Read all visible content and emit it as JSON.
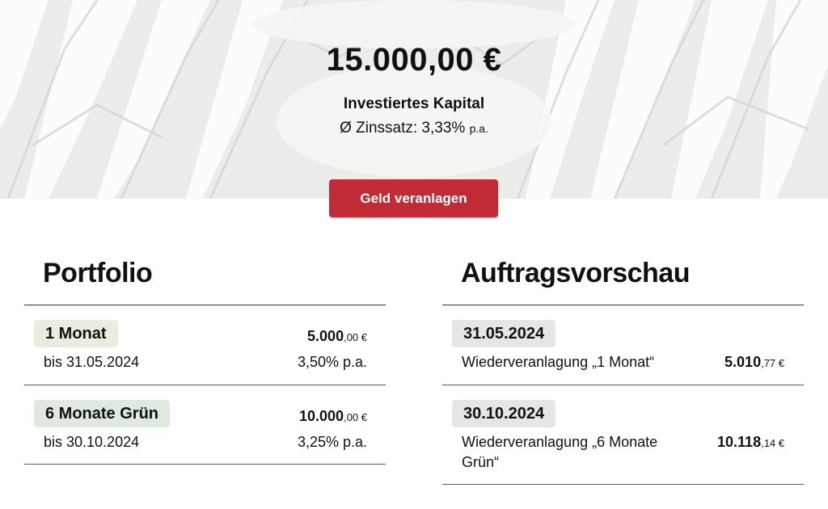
{
  "summary": {
    "total": "15.000,00 €",
    "label": "Investiertes Kapital",
    "rate_prefix": "Ø Zinssatz: 3,33%",
    "rate_unit": "p.a."
  },
  "actions": {
    "invest_label": "Geld veranlagen"
  },
  "portfolio": {
    "title": "Portfolio",
    "items": [
      {
        "tag": "1 Monat",
        "until": "bis 31.05.2024",
        "amount_main": "5.000",
        "amount_cents": ",00 €",
        "rate": "3,50% p.a."
      },
      {
        "tag": "6 Monate Grün",
        "until": "bis 30.10.2024",
        "amount_main": "10.000",
        "amount_cents": ",00 €",
        "rate": "3,25% p.a."
      }
    ]
  },
  "preview": {
    "title": "Auftragsvorschau",
    "items": [
      {
        "date": "31.05.2024",
        "desc_line1": "Wiederveranlagung „1 Monat“",
        "desc_line2": "",
        "amount_main": "5.010",
        "amount_cents": ",77 €"
      },
      {
        "date": "30.10.2024",
        "desc_line1": "Wiederveranlagung „6 Monate",
        "desc_line2": "Grün“",
        "amount_main": "10.118",
        "amount_cents": ",14 €"
      }
    ]
  },
  "colors": {
    "primary_button": "#c22b35",
    "hero_bg": "#ececea",
    "tag_beige": "#ecebe0",
    "tag_green": "#dfeadf",
    "tag_grey": "#e6e6e6"
  }
}
